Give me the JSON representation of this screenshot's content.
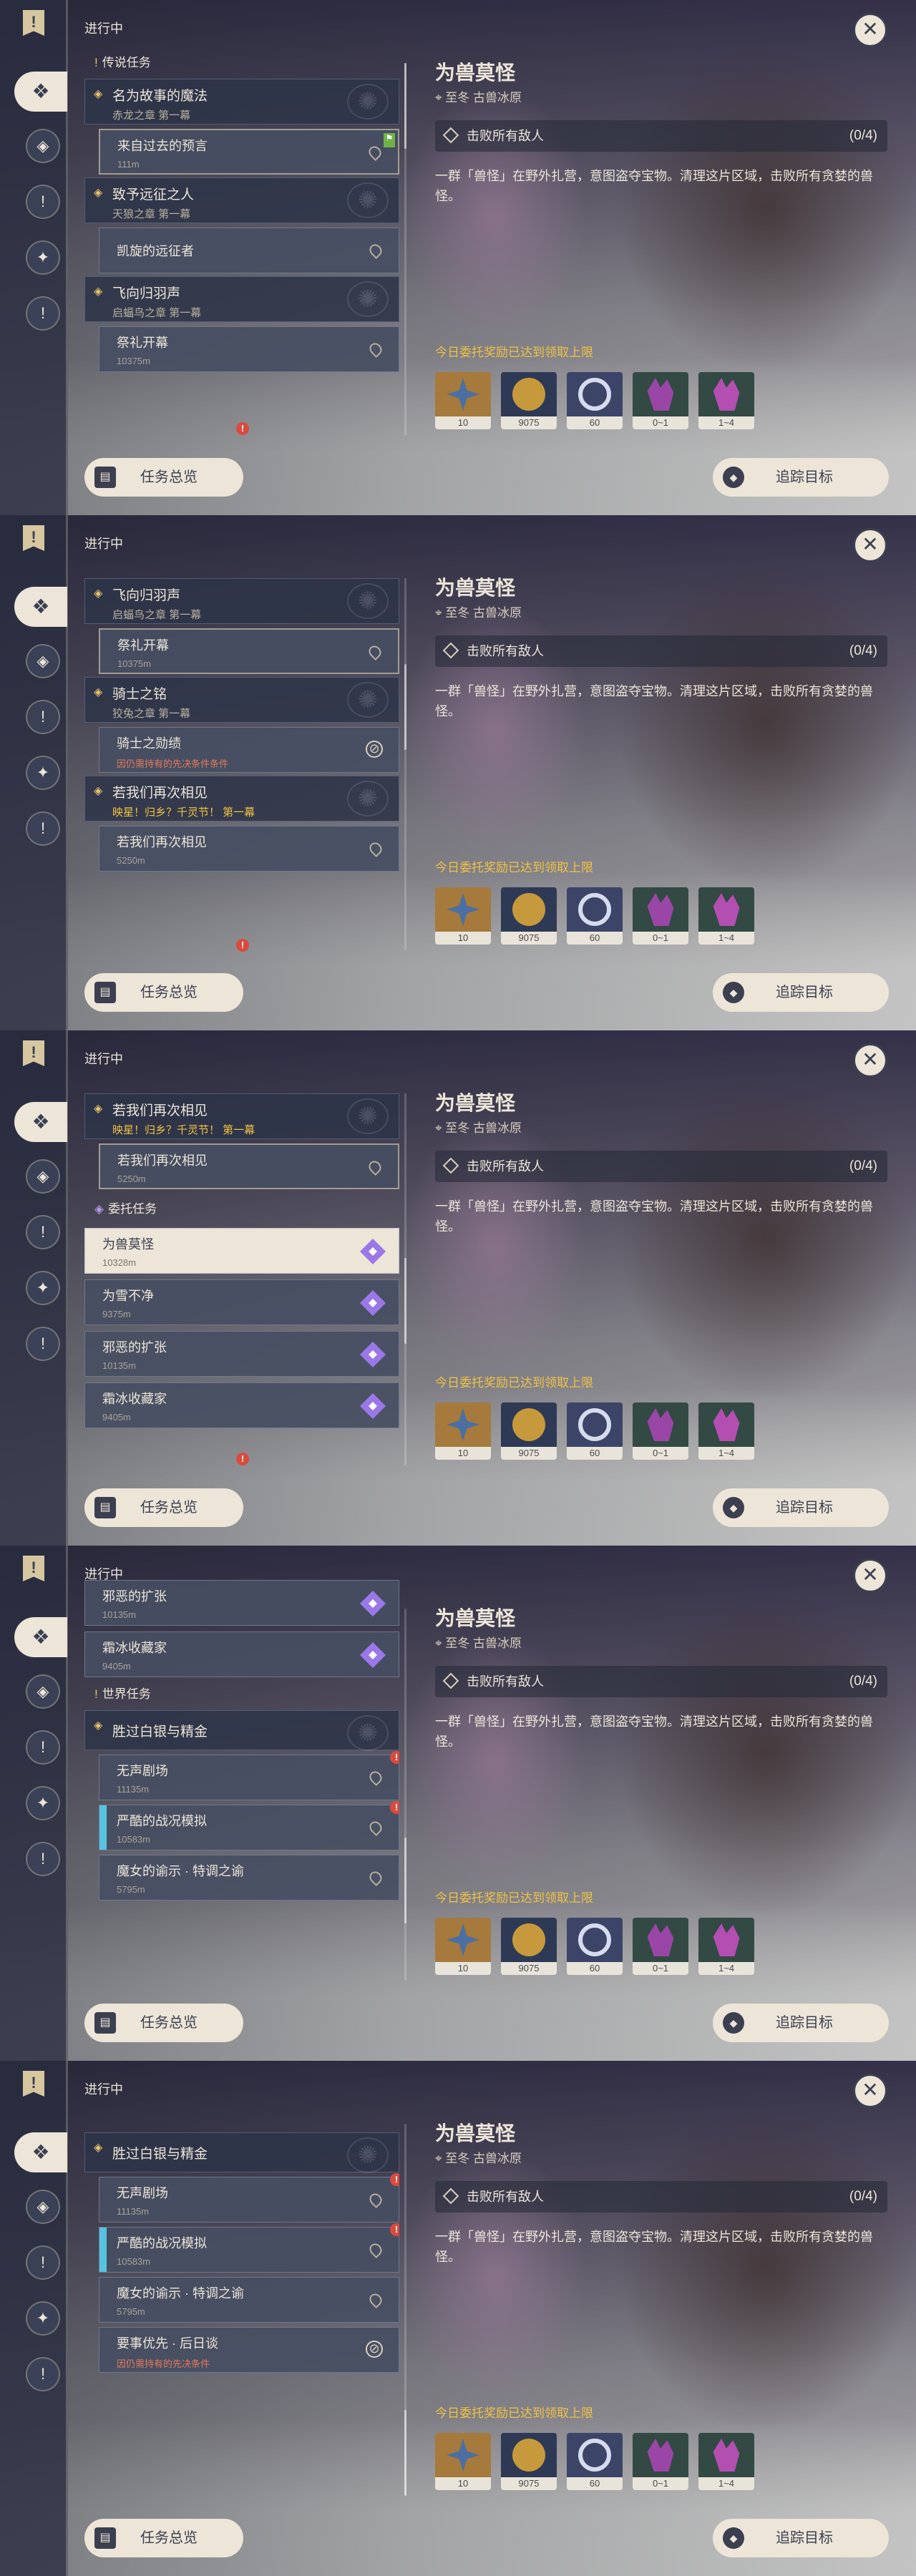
{
  "header": {
    "in_progress": "进行中"
  },
  "detail": {
    "title": "为兽莫怪",
    "location": "至冬 古兽冰原",
    "objective": "击败所有敌人",
    "progress": "(0/4)",
    "description": "一群「兽怪」在野外扎营，意图盗夺宝物。清理这片区域，击败所有贪婪的兽怪。",
    "reward_warning": "今日委托奖励已达到领取上限",
    "rewards": [
      {
        "name": "reward-adventure-exp",
        "qty": "10",
        "color": "#4b6fa3",
        "bg": "#a57a3c"
      },
      {
        "name": "reward-mora",
        "qty": "9075",
        "color": "#c69a3c",
        "bg": "#2e3a55"
      },
      {
        "name": "reward-fate",
        "qty": "60",
        "color": "#aeb4d0",
        "bg": "#3c4468"
      },
      {
        "name": "reward-crystal",
        "qty": "0~1",
        "color": "#9a46a6",
        "bg": "#334944"
      },
      {
        "name": "reward-ore",
        "qty": "1~4",
        "color": "#b34fb0",
        "bg": "#334944"
      }
    ]
  },
  "buttons": {
    "overview": "任务总览",
    "track": "追踪目标"
  },
  "sections": {
    "legend": "传说任务",
    "commission": "委托任务",
    "world": "世界任务"
  },
  "legend_groups": [
    {
      "title": "名为故事的魔法",
      "subtitle": "赤龙之章 第一幕"
    },
    {
      "title": "致予远征之人",
      "subtitle": "天狼之章 第一幕"
    },
    {
      "title": "飞向归羽声",
      "subtitle": "启蝠鸟之章 第一幕"
    },
    {
      "title": "骑士之铭",
      "subtitle": "狡兔之章 第一幕"
    },
    {
      "title": "若我们再次相见",
      "subtitle": "映星！归乡？千灵节！ 第一幕"
    }
  ],
  "legend_subs": [
    {
      "title": "来自过去的预言",
      "dist": "111m"
    },
    {
      "title": "凯旋的远征者",
      "dist": ""
    },
    {
      "title": "祭礼开幕",
      "dist": "10375m"
    },
    {
      "title": "骑士之勋绩",
      "dist": "因仍需持有的先决条件条件"
    },
    {
      "title": "若我们再次相见",
      "dist": "5250m"
    }
  ],
  "commissions": [
    {
      "title": "为兽莫怪",
      "dist": "10328m"
    },
    {
      "title": "为雪不净",
      "dist": "9375m"
    },
    {
      "title": "邪恶的扩张",
      "dist": "10135m"
    },
    {
      "title": "霜冰收藏家",
      "dist": "9405m"
    }
  ],
  "world_group": {
    "title": "胜过白银与精金"
  },
  "world_subs": [
    {
      "title": "无声剧场",
      "dist": "11135m"
    },
    {
      "title": "严酷的战况模拟",
      "dist": "10583m"
    },
    {
      "title": "魔女的谕示 · 特调之谕",
      "dist": "5795m"
    },
    {
      "title": "要事优先 · 后日谈",
      "dist": "因仍需持有的先决条件"
    }
  ]
}
